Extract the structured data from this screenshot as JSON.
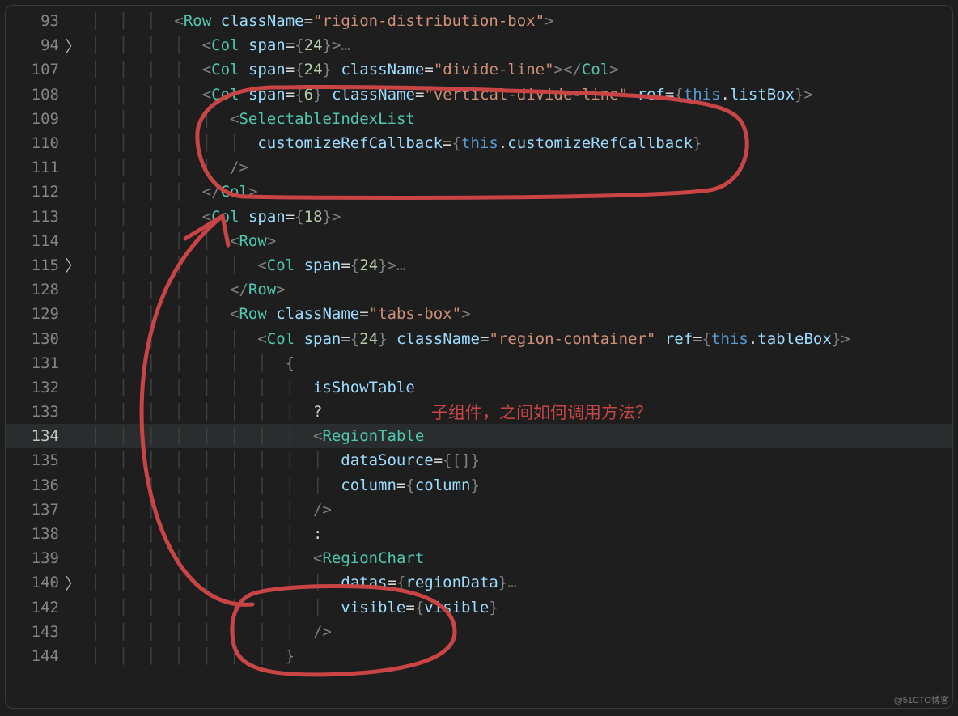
{
  "watermark": "@51CTO博客",
  "annotation": "子组件，之间如何调用方法？",
  "annotation_color": "#c94545",
  "fold_glyph": "〉",
  "ellipsis_glyph": "…",
  "highlighted_line": 134,
  "lines": [
    {
      "num": 93,
      "fold": false,
      "indent": 3,
      "tokens": [
        [
          "p",
          "<"
        ],
        [
          "t",
          "Row"
        ],
        [
          "op",
          " "
        ],
        [
          "a",
          "className"
        ],
        [
          "op",
          "="
        ],
        [
          "s",
          "\"rigion-distribution-box\""
        ],
        [
          "p",
          ">"
        ]
      ]
    },
    {
      "num": 94,
      "fold": true,
      "indent": 4,
      "tokens": [
        [
          "p",
          "<"
        ],
        [
          "t",
          "Col"
        ],
        [
          "op",
          " "
        ],
        [
          "a",
          "span"
        ],
        [
          "op",
          "="
        ],
        [
          "p",
          "{"
        ],
        [
          "n",
          "24"
        ],
        [
          "p",
          "}"
        ],
        [
          "p",
          ">"
        ],
        [
          "hd",
          "…"
        ]
      ]
    },
    {
      "num": 107,
      "fold": false,
      "indent": 4,
      "tokens": [
        [
          "p",
          "<"
        ],
        [
          "t",
          "Col"
        ],
        [
          "op",
          " "
        ],
        [
          "a",
          "span"
        ],
        [
          "op",
          "="
        ],
        [
          "p",
          "{"
        ],
        [
          "n",
          "24"
        ],
        [
          "p",
          "}"
        ],
        [
          "op",
          " "
        ],
        [
          "a",
          "className"
        ],
        [
          "op",
          "="
        ],
        [
          "s",
          "\"divide-line\""
        ],
        [
          "p",
          "></"
        ],
        [
          "t",
          "Col"
        ],
        [
          "p",
          ">"
        ]
      ]
    },
    {
      "num": 108,
      "fold": false,
      "indent": 4,
      "tokens": [
        [
          "p",
          "<"
        ],
        [
          "t",
          "Col"
        ],
        [
          "op",
          " "
        ],
        [
          "a",
          "span"
        ],
        [
          "op",
          "="
        ],
        [
          "p",
          "{"
        ],
        [
          "n",
          "6"
        ],
        [
          "p",
          "}"
        ],
        [
          "op",
          " "
        ],
        [
          "a",
          "className"
        ],
        [
          "op",
          "="
        ],
        [
          "s",
          "\"vertical-divide-line\""
        ],
        [
          "op",
          " "
        ],
        [
          "a",
          "ref"
        ],
        [
          "op",
          "="
        ],
        [
          "p",
          "{"
        ],
        [
          "kw",
          "this"
        ],
        [
          "op",
          "."
        ],
        [
          "a",
          "listBox"
        ],
        [
          "p",
          "}"
        ],
        [
          "p",
          ">"
        ]
      ]
    },
    {
      "num": 109,
      "fold": false,
      "indent": 5,
      "tokens": [
        [
          "p",
          "<"
        ],
        [
          "t",
          "SelectableIndexList"
        ]
      ]
    },
    {
      "num": 110,
      "fold": false,
      "indent": 6,
      "tokens": [
        [
          "a",
          "customizeRefCallback"
        ],
        [
          "op",
          "="
        ],
        [
          "p",
          "{"
        ],
        [
          "kw",
          "this"
        ],
        [
          "op",
          "."
        ],
        [
          "a",
          "customizeRefCallback"
        ],
        [
          "p",
          "}"
        ]
      ]
    },
    {
      "num": 111,
      "fold": false,
      "indent": 5,
      "tokens": [
        [
          "p",
          "/>"
        ]
      ]
    },
    {
      "num": 112,
      "fold": false,
      "indent": 4,
      "tokens": [
        [
          "p",
          "</"
        ],
        [
          "t",
          "Col"
        ],
        [
          "p",
          ">"
        ]
      ]
    },
    {
      "num": 113,
      "fold": false,
      "indent": 4,
      "tokens": [
        [
          "p",
          "<"
        ],
        [
          "t",
          "Col"
        ],
        [
          "op",
          " "
        ],
        [
          "a",
          "span"
        ],
        [
          "op",
          "="
        ],
        [
          "p",
          "{"
        ],
        [
          "n",
          "18"
        ],
        [
          "p",
          "}"
        ],
        [
          "p",
          ">"
        ]
      ]
    },
    {
      "num": 114,
      "fold": false,
      "indent": 5,
      "tokens": [
        [
          "p",
          "<"
        ],
        [
          "t",
          "Row"
        ],
        [
          "p",
          ">"
        ]
      ]
    },
    {
      "num": 115,
      "fold": true,
      "indent": 6,
      "tokens": [
        [
          "p",
          "<"
        ],
        [
          "t",
          "Col"
        ],
        [
          "op",
          " "
        ],
        [
          "a",
          "span"
        ],
        [
          "op",
          "="
        ],
        [
          "p",
          "{"
        ],
        [
          "n",
          "24"
        ],
        [
          "p",
          "}"
        ],
        [
          "p",
          ">"
        ],
        [
          "hd",
          "…"
        ]
      ]
    },
    {
      "num": 128,
      "fold": false,
      "indent": 5,
      "tokens": [
        [
          "p",
          "</"
        ],
        [
          "t",
          "Row"
        ],
        [
          "p",
          ">"
        ]
      ]
    },
    {
      "num": 129,
      "fold": false,
      "indent": 5,
      "tokens": [
        [
          "p",
          "<"
        ],
        [
          "t",
          "Row"
        ],
        [
          "op",
          " "
        ],
        [
          "a",
          "className"
        ],
        [
          "op",
          "="
        ],
        [
          "s",
          "\"tabs-box\""
        ],
        [
          "p",
          ">"
        ]
      ]
    },
    {
      "num": 130,
      "fold": false,
      "indent": 6,
      "tokens": [
        [
          "p",
          "<"
        ],
        [
          "t",
          "Col"
        ],
        [
          "op",
          " "
        ],
        [
          "a",
          "span"
        ],
        [
          "op",
          "="
        ],
        [
          "p",
          "{"
        ],
        [
          "n",
          "24"
        ],
        [
          "p",
          "}"
        ],
        [
          "op",
          " "
        ],
        [
          "a",
          "className"
        ],
        [
          "op",
          "="
        ],
        [
          "s",
          "\"region-container\""
        ],
        [
          "op",
          " "
        ],
        [
          "a",
          "ref"
        ],
        [
          "op",
          "="
        ],
        [
          "p",
          "{"
        ],
        [
          "kw",
          "this"
        ],
        [
          "op",
          "."
        ],
        [
          "a",
          "tableBox"
        ],
        [
          "p",
          "}"
        ],
        [
          "p",
          ">"
        ]
      ]
    },
    {
      "num": 131,
      "fold": false,
      "indent": 7,
      "tokens": [
        [
          "p",
          "{"
        ]
      ]
    },
    {
      "num": 132,
      "fold": false,
      "indent": 8,
      "tokens": [
        [
          "a",
          "isShowTable"
        ]
      ]
    },
    {
      "num": 133,
      "fold": false,
      "indent": 8,
      "tokens": [
        [
          "op",
          "?"
        ]
      ]
    },
    {
      "num": 134,
      "fold": false,
      "indent": 8,
      "tokens": [
        [
          "p",
          "<"
        ],
        [
          "t",
          "RegionTable"
        ]
      ]
    },
    {
      "num": 135,
      "fold": false,
      "indent": 9,
      "tokens": [
        [
          "a",
          "dataSource"
        ],
        [
          "op",
          "="
        ],
        [
          "p",
          "{"
        ],
        [
          "p",
          "[]"
        ],
        [
          "p",
          "}"
        ]
      ]
    },
    {
      "num": 136,
      "fold": false,
      "indent": 9,
      "tokens": [
        [
          "a",
          "column"
        ],
        [
          "op",
          "="
        ],
        [
          "p",
          "{"
        ],
        [
          "a",
          "column"
        ],
        [
          "p",
          "}"
        ]
      ]
    },
    {
      "num": 137,
      "fold": false,
      "indent": 8,
      "tokens": [
        [
          "p",
          "/>"
        ]
      ]
    },
    {
      "num": 138,
      "fold": false,
      "indent": 8,
      "tokens": [
        [
          "op",
          ":"
        ]
      ]
    },
    {
      "num": 139,
      "fold": false,
      "indent": 8,
      "tokens": [
        [
          "p",
          "<"
        ],
        [
          "t",
          "RegionChart"
        ]
      ]
    },
    {
      "num": 140,
      "fold": true,
      "indent": 9,
      "tokens": [
        [
          "a",
          "datas"
        ],
        [
          "op",
          "="
        ],
        [
          "p",
          "{"
        ],
        [
          "a",
          "regionData"
        ],
        [
          "p",
          "}"
        ],
        [
          "hd",
          "…"
        ]
      ]
    },
    {
      "num": 142,
      "fold": false,
      "indent": 9,
      "tokens": [
        [
          "a",
          "visible"
        ],
        [
          "op",
          "="
        ],
        [
          "p",
          "{"
        ],
        [
          "a",
          "visible"
        ],
        [
          "p",
          "}"
        ]
      ]
    },
    {
      "num": 143,
      "fold": false,
      "indent": 8,
      "tokens": [
        [
          "p",
          "/>"
        ]
      ]
    },
    {
      "num": 144,
      "fold": false,
      "indent": 7,
      "tokens": [
        [
          "p",
          "}"
        ]
      ]
    }
  ]
}
